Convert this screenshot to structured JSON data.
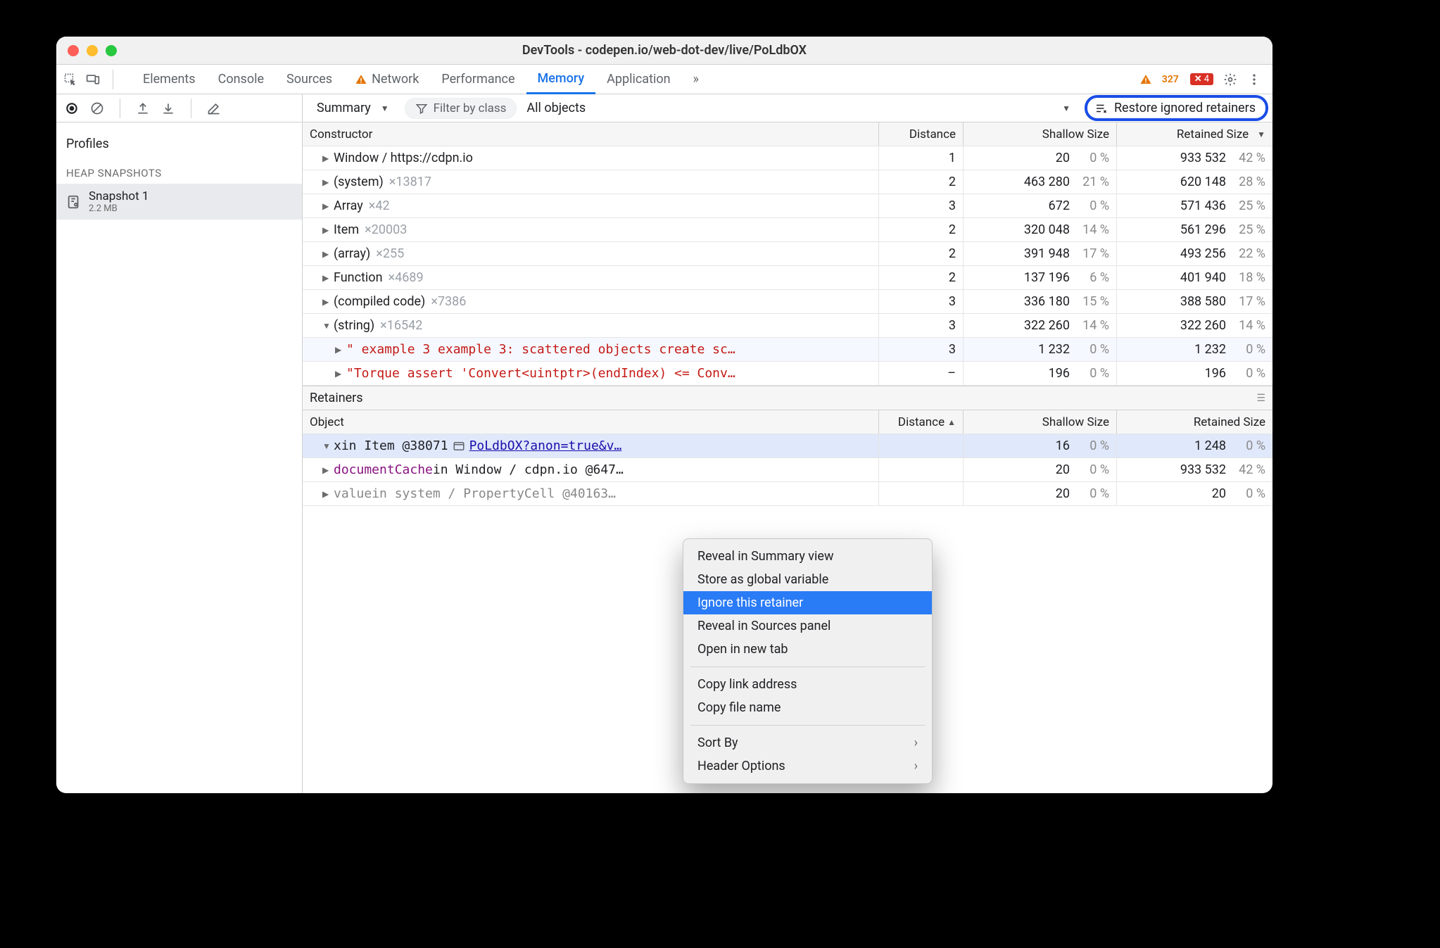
{
  "titlebar": {
    "title": "DevTools - codepen.io/web-dot-dev/live/PoLdbOX"
  },
  "tabs": {
    "items": [
      "Elements",
      "Console",
      "Sources",
      "Network",
      "Performance",
      "Memory",
      "Application"
    ],
    "active": "Memory",
    "more": "»"
  },
  "counters": {
    "warnings": "327",
    "errors": "4"
  },
  "toolbar": {
    "summary": "Summary",
    "filter_placeholder": "Filter by class",
    "all_objects": "All objects",
    "restore": "Restore ignored retainers"
  },
  "sidebar": {
    "profiles": "Profiles",
    "category": "HEAP SNAPSHOTS",
    "snapshot": {
      "name": "Snapshot 1",
      "size": "2.2 MB"
    }
  },
  "grid": {
    "headers": {
      "constructor": "Constructor",
      "distance": "Distance",
      "shallow": "Shallow Size",
      "retained": "Retained Size"
    },
    "rows": [
      {
        "name": "Window / https://cdpn.io",
        "count": "",
        "dist": "1",
        "sh": "20",
        "shp": "0 %",
        "re": "933 532",
        "rep": "42 %",
        "expand": "closed"
      },
      {
        "name": "(system)",
        "count": "×13817",
        "dist": "2",
        "sh": "463 280",
        "shp": "21 %",
        "re": "620 148",
        "rep": "28 %",
        "expand": "closed"
      },
      {
        "name": "Array",
        "count": "×42",
        "dist": "3",
        "sh": "672",
        "shp": "0 %",
        "re": "571 436",
        "rep": "25 %",
        "expand": "closed"
      },
      {
        "name": "Item",
        "count": "×20003",
        "dist": "2",
        "sh": "320 048",
        "shp": "14 %",
        "re": "561 296",
        "rep": "25 %",
        "expand": "closed"
      },
      {
        "name": "(array)",
        "count": "×255",
        "dist": "2",
        "sh": "391 948",
        "shp": "17 %",
        "re": "493 256",
        "rep": "22 %",
        "expand": "closed"
      },
      {
        "name": "Function",
        "count": "×4689",
        "dist": "2",
        "sh": "137 196",
        "shp": "6 %",
        "re": "401 940",
        "rep": "18 %",
        "expand": "closed"
      },
      {
        "name": "(compiled code)",
        "count": "×7386",
        "dist": "3",
        "sh": "336 180",
        "shp": "15 %",
        "re": "388 580",
        "rep": "17 %",
        "expand": "closed"
      },
      {
        "name": "(string)",
        "count": "×16542",
        "dist": "3",
        "sh": "322 260",
        "shp": "14 %",
        "re": "322 260",
        "rep": "14 %",
        "expand": "open"
      }
    ],
    "children": [
      {
        "text": "\" example 3 example 3: scattered objects create sc…",
        "dist": "3",
        "sh": "1 232",
        "shp": "0 %",
        "re": "1 232",
        "rep": "0 %",
        "mono": true,
        "cls": "str-red",
        "sel": true
      },
      {
        "text": "\"Torque assert 'Convert<uintptr>(endIndex) <= Conv…",
        "dist": "–",
        "sh": "196",
        "shp": "0 %",
        "re": "196",
        "rep": "0 %",
        "mono": true,
        "cls": "str-red"
      }
    ]
  },
  "retainers": {
    "title": "Retainers",
    "headers": {
      "object": "Object",
      "distance": "Distance",
      "shallow": "Shallow Size",
      "retained": "Retained Size"
    },
    "rows": [
      {
        "prefix": "x",
        "mid": " in Item @38071 ",
        "link": "PoLdbOX?anon=true&v…",
        "dist": "",
        "sh": "16",
        "shp": "0 %",
        "re": "1 248",
        "rep": "0 %",
        "expand": "open",
        "sel": true
      },
      {
        "prefix": "documentCache",
        "mid": " in Window / cdpn.io @647…",
        "dist": "",
        "sh": "20",
        "shp": "0 %",
        "re": "933 532",
        "rep": "42 %",
        "expand": "closed",
        "style": "key"
      },
      {
        "prefix": "value",
        "mid": " in system / PropertyCell @40163…",
        "dist": "",
        "sh": "20",
        "shp": "0 %",
        "re": "20",
        "rep": "0 %",
        "expand": "closed",
        "style": "gray"
      }
    ]
  },
  "context_menu": {
    "items": [
      {
        "label": "Reveal in Summary view",
        "type": "item"
      },
      {
        "label": "Store as global variable",
        "type": "item"
      },
      {
        "label": "Ignore this retainer",
        "type": "item",
        "highlight": true
      },
      {
        "label": "Reveal in Sources panel",
        "type": "item"
      },
      {
        "label": "Open in new tab",
        "type": "item"
      },
      {
        "type": "sep"
      },
      {
        "label": "Copy link address",
        "type": "item"
      },
      {
        "label": "Copy file name",
        "type": "item"
      },
      {
        "type": "sep"
      },
      {
        "label": "Sort By",
        "type": "submenu"
      },
      {
        "label": "Header Options",
        "type": "submenu"
      }
    ]
  }
}
